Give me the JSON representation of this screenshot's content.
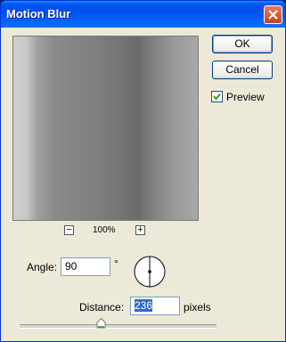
{
  "window": {
    "title": "Motion Blur"
  },
  "buttons": {
    "ok": "OK",
    "cancel": "Cancel"
  },
  "preview": {
    "checkbox_label": "Preview",
    "checked": true
  },
  "zoom": {
    "minus": "−",
    "plus": "+",
    "level": "100%"
  },
  "angle": {
    "label": "Angle:",
    "value": "90",
    "unit": "°"
  },
  "distance": {
    "label": "Distance:",
    "value": "236",
    "unit": "pixels"
  },
  "slider": {
    "value_fraction": 0.43
  },
  "colors": {
    "title_bar": "#0053ee",
    "dialog_bg": "#ece9d8",
    "selection": "#316ac5"
  }
}
